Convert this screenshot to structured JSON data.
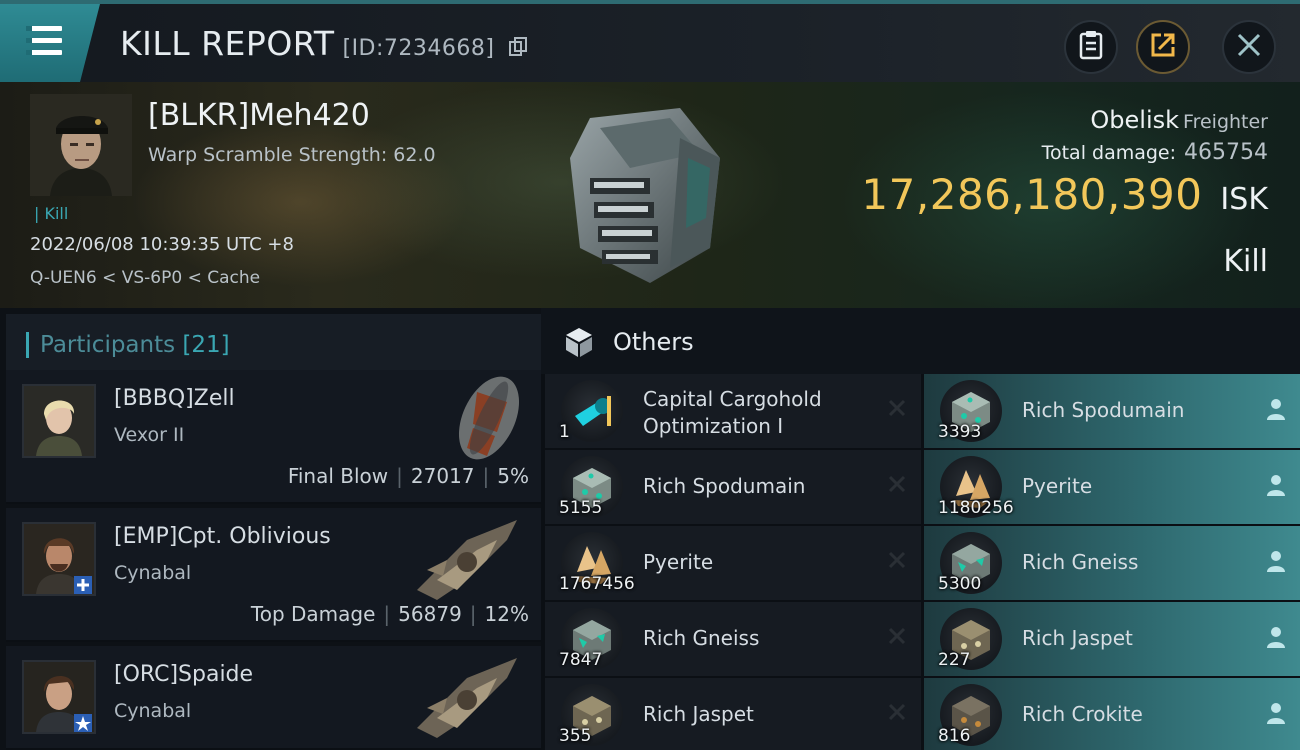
{
  "header": {
    "title": "KILL REPORT",
    "report_id": "[ID:7234668]"
  },
  "victim": {
    "name": "[BLKR]Meh420",
    "warp_scramble": "Warp Scramble Strength: 62.0",
    "kill_tag": "| Kill",
    "datetime": "2022/06/08 10:39:35 UTC +8",
    "location": "Q-UEN6 < VS-6P0 < Cache",
    "ship_name": "Obelisk",
    "ship_class": "Freighter",
    "total_damage_label": "Total damage:",
    "total_damage": "465754",
    "isk_value": "17,286,180,390",
    "isk_unit": "ISK",
    "result": "Kill"
  },
  "participants": {
    "label": "Participants",
    "count": "[21]",
    "list": [
      {
        "name": "[BBBQ]Zell",
        "ship": "Vexor II",
        "role": "Final Blow",
        "damage": "27017",
        "percent": "5%"
      },
      {
        "name": "[EMP]Cpt. Oblivious",
        "ship": "Cynabal",
        "role": "Top Damage",
        "damage": "56879",
        "percent": "12%"
      },
      {
        "name": "[ORC]Spaide",
        "ship": "Cynabal"
      }
    ]
  },
  "others": {
    "label": "Others",
    "destroyed": [
      {
        "name": "Capital Cargohold Optimization I",
        "line1": "Capital Cargohold",
        "line2": "Optimization I",
        "qty": "1"
      },
      {
        "name": "Rich Spodumain",
        "qty": "5155"
      },
      {
        "name": "Pyerite",
        "qty": "1767456"
      },
      {
        "name": "Rich Gneiss",
        "qty": "7847"
      },
      {
        "name": "Rich Jaspet",
        "qty": "355"
      }
    ],
    "dropped": [
      {
        "name": "Rich Spodumain",
        "qty": "3393"
      },
      {
        "name": "Pyerite",
        "qty": "1180256"
      },
      {
        "name": "Rich Gneiss",
        "qty": "5300"
      },
      {
        "name": "Rich Jaspet",
        "qty": "227"
      },
      {
        "name": "Rich Crokite",
        "qty": "816"
      }
    ]
  },
  "colors": {
    "accent": "#3aa7b3",
    "isk": "#f2c75a",
    "dropped_bg": "#3f8a8f"
  },
  "icons": {
    "menu": "hamburger-icon",
    "copy": "copy-icon",
    "clipboard": "clipboard-icon",
    "share": "share-icon",
    "close": "close-icon",
    "others": "cube-icon",
    "destroyed": "x-icon",
    "dropped": "person-icon"
  }
}
